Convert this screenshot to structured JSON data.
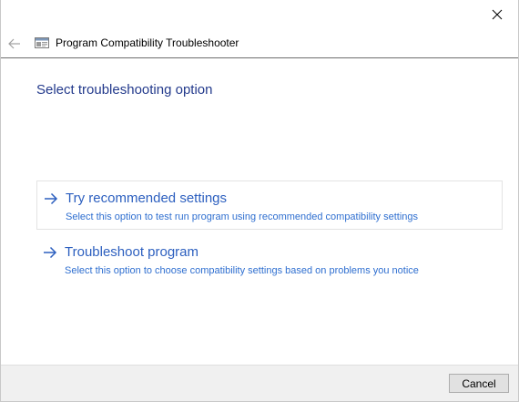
{
  "window": {
    "close_icon": "close-icon"
  },
  "nav": {
    "back_icon": "back-arrow-icon",
    "app_icon": "troubleshooter-app-icon",
    "title": "Program Compatibility Troubleshooter"
  },
  "main": {
    "heading": "Select troubleshooting option",
    "options": [
      {
        "icon": "arrow-right-icon",
        "title": "Try recommended settings",
        "description": "Select this option to test run program using recommended compatibility settings"
      },
      {
        "icon": "arrow-right-icon",
        "title": "Troubleshoot program",
        "description": "Select this option to choose compatibility settings based on problems you notice"
      }
    ]
  },
  "footer": {
    "cancel_label": "Cancel"
  },
  "colors": {
    "link_title": "#2c5fbf",
    "link_desc": "#2f6fd0",
    "heading": "#233a8c",
    "footer_bg": "#f0f0f0"
  }
}
